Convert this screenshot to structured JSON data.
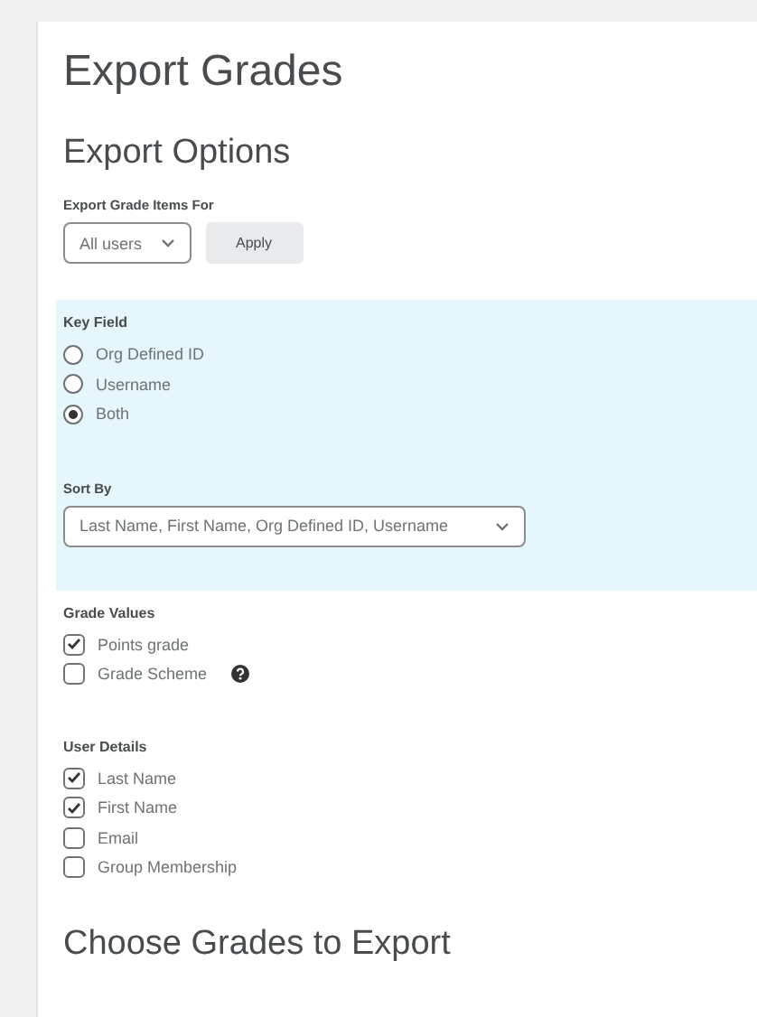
{
  "page_title": "Export Grades",
  "export_options": {
    "heading": "Export Options",
    "grade_items_for": {
      "label": "Export Grade Items For",
      "value": "All users",
      "apply_button": "Apply"
    },
    "key_field": {
      "label": "Key Field",
      "options": [
        {
          "label": "Org Defined ID",
          "selected": false
        },
        {
          "label": "Username",
          "selected": false
        },
        {
          "label": "Both",
          "selected": true
        }
      ]
    },
    "sort_by": {
      "label": "Sort By",
      "value": "Last Name, First Name, Org Defined ID, Username"
    },
    "grade_values": {
      "label": "Grade Values",
      "options": [
        {
          "label": "Points grade",
          "checked": true,
          "help": false
        },
        {
          "label": "Grade Scheme",
          "checked": false,
          "help": true
        }
      ]
    },
    "user_details": {
      "label": "User Details",
      "options": [
        {
          "label": "Last Name",
          "checked": true
        },
        {
          "label": "First Name",
          "checked": true
        },
        {
          "label": "Email",
          "checked": false
        },
        {
          "label": "Group Membership",
          "checked": false
        }
      ]
    }
  },
  "choose_grades": {
    "heading": "Choose Grades to Export"
  }
}
